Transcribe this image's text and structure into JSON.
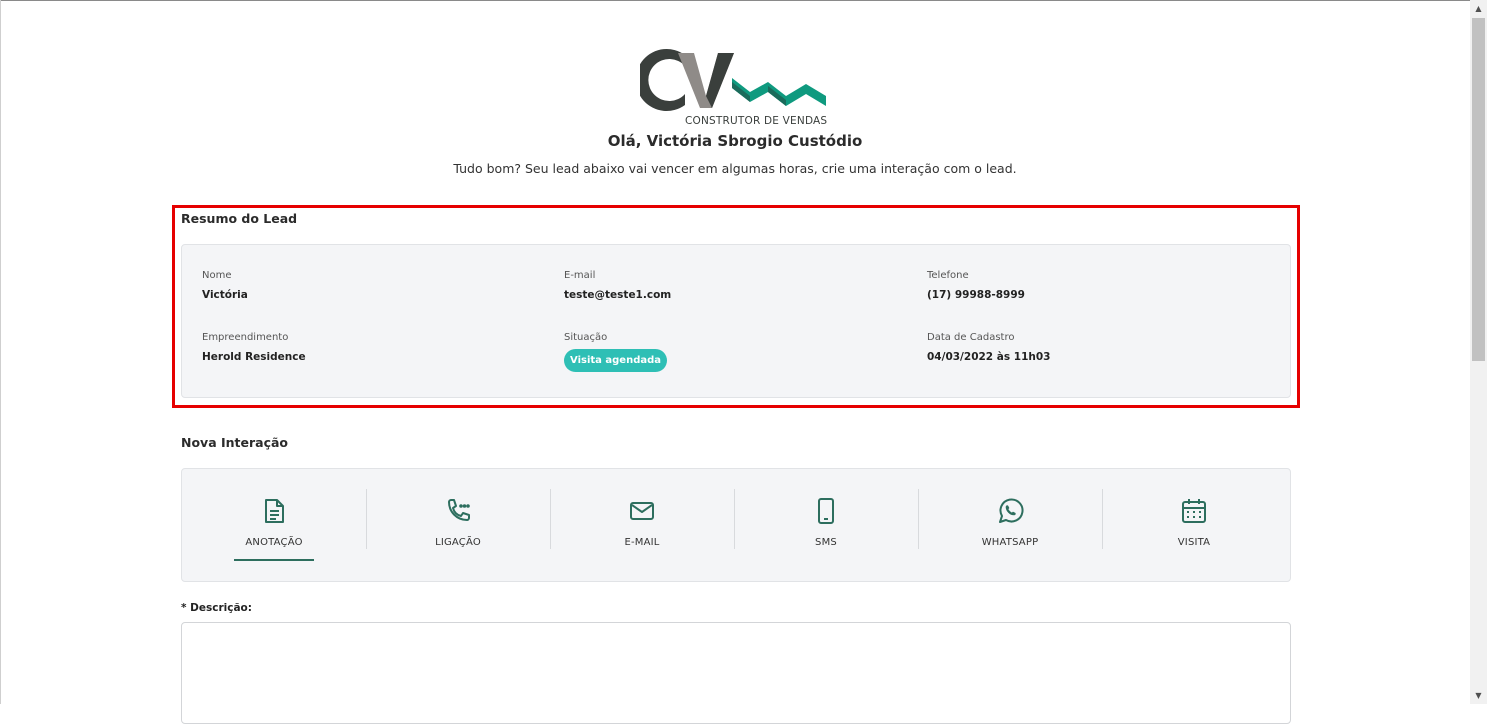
{
  "brand": {
    "logo_text": "CV",
    "tagline": "CONSTRUTOR DE VENDAS",
    "colors": {
      "dark": "#3a3f3c",
      "gray": "#8f8b88",
      "green": "#0f9a7f",
      "teal_dark": "#1b6b5b"
    }
  },
  "greeting": "Olá, Victória Sbrogio Custódio",
  "subtitle": "Tudo bom? Seu lead abaixo vai vencer em algumas horas, crie uma interação com o lead.",
  "lead_summary": {
    "title": "Resumo do Lead",
    "fields": {
      "nome": {
        "label": "Nome",
        "value": "Victória"
      },
      "email": {
        "label": "E-mail",
        "value": "teste@teste1.com"
      },
      "telefone": {
        "label": "Telefone",
        "value": "(17) 99988-8999"
      },
      "empreendimento": {
        "label": "Empreendimento",
        "value": "Herold Residence"
      },
      "situacao": {
        "label": "Situação",
        "value": "Visita agendada",
        "badge_color": "#2ebfb5"
      },
      "data_cadastro": {
        "label": "Data de Cadastro",
        "value": "04/03/2022 às 11h03"
      }
    }
  },
  "interaction": {
    "title": "Nova Interação",
    "tabs": [
      {
        "label": "ANOTAÇÃO",
        "icon": "document-icon",
        "active": true
      },
      {
        "label": "LIGAÇÃO",
        "icon": "phone-icon",
        "active": false
      },
      {
        "label": "E-MAIL",
        "icon": "mail-icon",
        "active": false
      },
      {
        "label": "SMS",
        "icon": "mobile-icon",
        "active": false
      },
      {
        "label": "WHATSAPP",
        "icon": "whatsapp-icon",
        "active": false
      },
      {
        "label": "VISITA",
        "icon": "calendar-icon",
        "active": false
      }
    ],
    "accent_color": "#2d6e5e",
    "description_label": "* Descrição:",
    "description_value": ""
  },
  "highlight_color": "#e60000"
}
